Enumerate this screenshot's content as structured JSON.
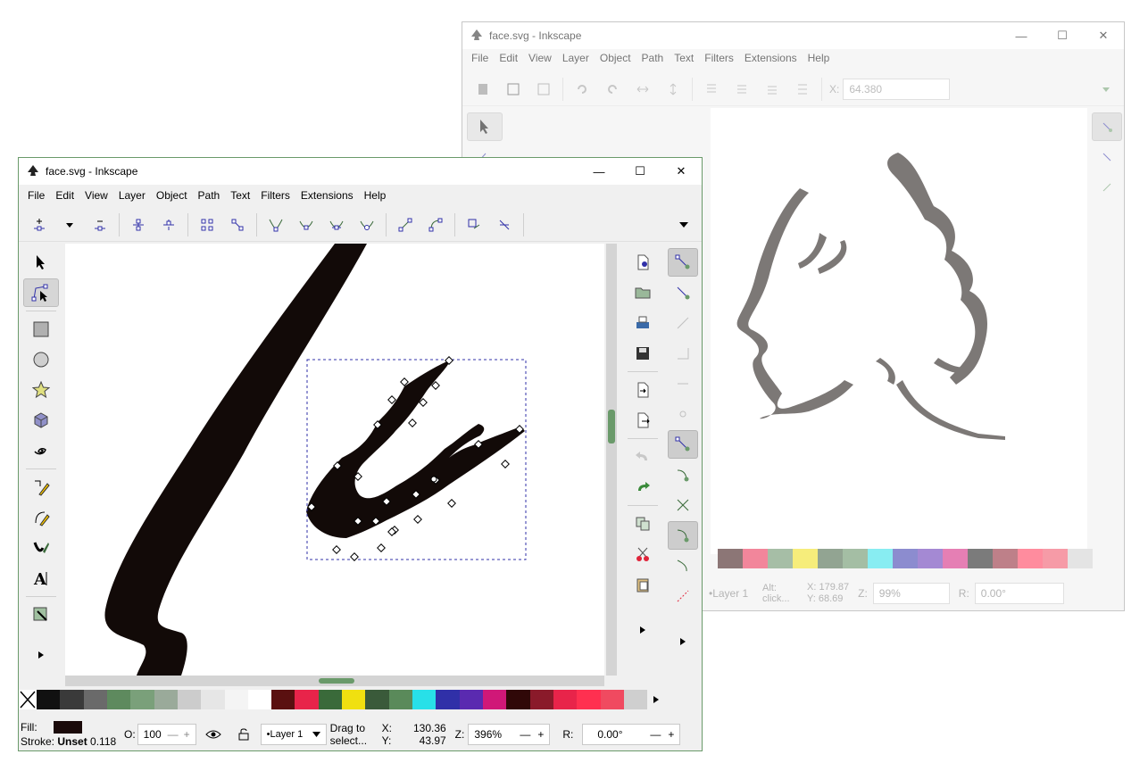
{
  "back_window": {
    "title": "face.svg - Inkscape",
    "menu": [
      "File",
      "Edit",
      "View",
      "Layer",
      "Object",
      "Path",
      "Text",
      "Filters",
      "Extensions",
      "Help"
    ],
    "x_label": "X:",
    "x_value": "64.380",
    "status": {
      "layer": "•Layer 1",
      "message": "Alt: click...",
      "x_label": "X:",
      "x": "179.87",
      "y_label": "Y:",
      "y": "68.69",
      "z_label": "Z:",
      "zoom": "99%",
      "r_label": "R:",
      "rotation": "0.00°"
    }
  },
  "front_window": {
    "title": "face.svg - Inkscape",
    "menu": [
      "File",
      "Edit",
      "View",
      "Layer",
      "Object",
      "Path",
      "Text",
      "Filters",
      "Extensions",
      "Help"
    ],
    "status": {
      "fill_label": "Fill:",
      "stroke_label": "Stroke:",
      "stroke_value": "Unset",
      "stroke_width": "0.118",
      "opacity_label": "O:",
      "opacity": "100",
      "layer": "•Layer 1",
      "message_line1": "Drag to",
      "message_line2": "select...",
      "x_label": "X:",
      "x": "130.36",
      "y_label": "Y:",
      "y": "43.97",
      "z_label": "Z:",
      "zoom": "396%",
      "r_label": "R:",
      "rotation": "0.00°"
    }
  },
  "window_controls": {
    "minimize": "—",
    "maximize": "☐",
    "close": "✕"
  },
  "icons": {
    "app": "inkscape-logo-icon",
    "tools": [
      "selector-icon",
      "node-tool-icon",
      "rectangle-icon",
      "ellipse-icon",
      "star-icon",
      "3d-box-icon",
      "spiral-icon",
      "pencil-icon",
      "pen-icon",
      "calligraphy-icon",
      "text-icon",
      "zoom-icon"
    ],
    "node_toolbar": [
      "insert-node-icon",
      "dropdown-icon",
      "delete-node-icon",
      "join-nodes-icon",
      "break-path-icon",
      "join-segment-icon",
      "delete-segment-icon",
      "cusp-node-icon",
      "smooth-node-icon",
      "symmetric-node-icon",
      "auto-smooth-icon",
      "segment-line-icon",
      "segment-curve-icon",
      "object-to-path-icon",
      "stroke-to-path-icon"
    ]
  },
  "colors": {
    "palette": [
      "#111111",
      "#3a3a3a",
      "#6a6a6a",
      "#5e8a5e",
      "#7aa07a",
      "#9aaa9a",
      "#cccccc",
      "#e6e6e6",
      "#f4f4f4",
      "#ffffff",
      "#5a1010",
      "#e8244a",
      "#3a6a3a",
      "#f0e010",
      "#3a5a3a",
      "#5a8a5a",
      "#28e0e8",
      "#3030a8",
      "#5a2ab0",
      "#d01878",
      "#300808",
      "#8a1a2a",
      "#e8244a",
      "#ff3050",
      "#f04a60",
      "#cfcfcf"
    ],
    "fill_swatch": "#1a0a0a",
    "accent_active": "#d6d6d6",
    "scroll_green": "#6a9a6a"
  }
}
